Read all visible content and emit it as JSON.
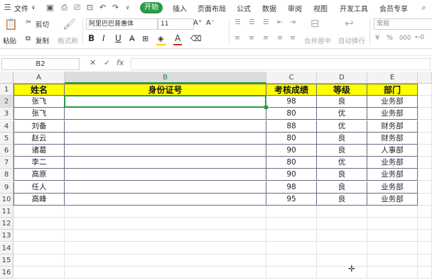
{
  "menu": {
    "file_label": "文件",
    "chevron": "∨",
    "start_label": "开始",
    "tabs": [
      "插入",
      "页面布局",
      "公式",
      "数据",
      "审阅",
      "视图",
      "开发工具",
      "会员专享"
    ]
  },
  "ribbon": {
    "paste_label": "粘贴",
    "cut_label": "剪切",
    "copy_label": "复制",
    "format_painter_label": "格式刷",
    "font_name": "阿里巴巴普惠体",
    "font_size": "11",
    "bold": "B",
    "italic": "I",
    "underline": "U",
    "merge_label": "合并居中",
    "wrap_label": "自动换行",
    "number_format": "常规",
    "percent": "%",
    "thousands": "000",
    "colors": {
      "accent": "#2a9a46",
      "font_color": "#e0201a",
      "fill_color": "#ffd200"
    }
  },
  "formula_bar": {
    "name_box": "B2",
    "cancel_icon": "✕",
    "confirm_icon": "✓",
    "fx_label": "fx",
    "value": ""
  },
  "sheet": {
    "columns": [
      "A",
      "B",
      "C",
      "D",
      "E"
    ],
    "selected_column": "B",
    "selected_row": 2,
    "row_numbers": [
      "1",
      "2",
      "3",
      "4",
      "5",
      "6",
      "7",
      "8",
      "9",
      "10",
      "11",
      "12",
      "13",
      "14",
      "15",
      "16"
    ],
    "header_row": [
      "姓名",
      "身份证号",
      "考核成绩",
      "等级",
      "部门"
    ],
    "rows": [
      [
        "张飞",
        "",
        "98",
        "良",
        "业务部"
      ],
      [
        "张飞",
        "",
        "80",
        "优",
        "业务部"
      ],
      [
        "刘备",
        "",
        "88",
        "优",
        "财务部"
      ],
      [
        "赵云",
        "",
        "80",
        "良",
        "财务部"
      ],
      [
        "诸葛",
        "",
        "90",
        "良",
        "人事部"
      ],
      [
        "李二",
        "",
        "80",
        "优",
        "业务部"
      ],
      [
        "高原",
        "",
        "90",
        "良",
        "业务部"
      ],
      [
        "任人",
        "",
        "98",
        "良",
        "业务部"
      ],
      [
        "高峰",
        "",
        "95",
        "良",
        "业务部"
      ]
    ],
    "header_fill": "#ffff00",
    "border_color": "#6a6a86"
  }
}
